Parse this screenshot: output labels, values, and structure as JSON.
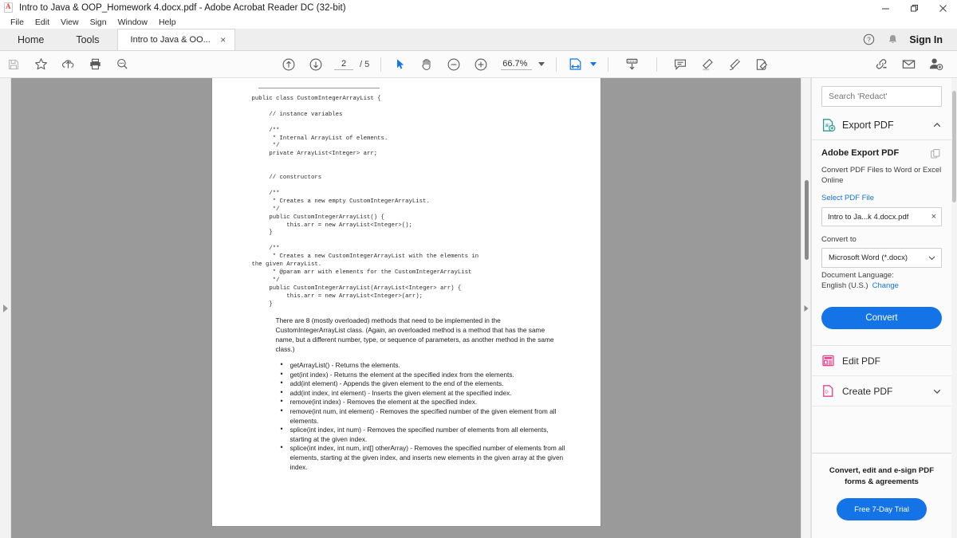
{
  "window": {
    "title": "Intro to Java & OOP_Homework 4.docx.pdf - Adobe Acrobat Reader DC (32-bit)",
    "minimize_label": "Minimize",
    "restore_label": "Restore",
    "close_label": "Close"
  },
  "menubar": {
    "items": [
      "File",
      "Edit",
      "View",
      "Sign",
      "Window",
      "Help"
    ]
  },
  "tabstrip": {
    "home": "Home",
    "tools": "Tools",
    "document_tab": "Intro to Java & OO...",
    "close_tab": "×",
    "help_icon": "help-circle-icon",
    "bell_icon": "notification-bell-icon",
    "sign_in": "Sign In"
  },
  "toolbar": {
    "save_icon": "save-icon",
    "star_icon": "add-to-favorites-star-icon",
    "upload_icon": "upload-to-cloud-icon",
    "print_icon": "print-icon",
    "search_icon": "search-magnifier-icon",
    "prev_page_icon": "previous-page-up-arrow-icon",
    "next_page_icon": "next-page-down-arrow-icon",
    "current_page": "2",
    "page_total": "/ 5",
    "select_tool_icon": "select-cursor-icon",
    "hand_tool_icon": "hand-pan-icon",
    "zoom_out_icon": "zoom-out-minus-icon",
    "zoom_in_icon": "zoom-in-plus-icon",
    "zoom_level": "66.7%",
    "zoom_dropdown_icon": "chevron-down-icon",
    "fit_page_icon": "fit-page-width-icon",
    "fit_page_dropdown_icon": "chevron-down-icon",
    "scroll_mode_icon": "page-scroll-down-icon",
    "comment_icon": "add-comment-icon",
    "highlight_icon": "highlight-text-icon",
    "draw_icon": "draw-freehand-icon",
    "fill_sign_icon": "fill-and-sign-icon",
    "share_link_icon": "share-link-icon",
    "email_icon": "send-email-icon",
    "add_person_icon": "add-person-icon"
  },
  "viewer": {
    "left_rail_expand_icon": "expand-left-panel-arrow-icon",
    "right_rail_expand_icon": "expand-right-panel-arrow-icon",
    "scrollbar_name": "document-vertical-scrollbar"
  },
  "document": {
    "code": "public class CustomIntegerArrayList {\n\n     // instance variables\n\n     /**\n      * Internal ArrayList of elements.\n      */\n     private ArrayList<Integer> arr;\n\n\n     // constructors\n\n     /**\n      * Creates a new empty CustomIntegerArrayList.\n      */\n     public CustomIntegerArrayList() {\n          this.arr = new ArrayList<Integer>();\n     }\n\n     /**\n      * Creates a new CustomIntegerArrayList with the elements in\nthe given ArrayList.\n      * @param arr with elements for the CustomIntegerArrayList\n      */\n     public CustomIntegerArrayList(ArrayList<Integer> arr) {\n          this.arr = new ArrayList<Integer>(arr);\n     }",
    "paragraph": "There are 8 (mostly overloaded) methods that need to be implemented in the CustomIntegerArrayList class.  (Again, an overloaded method is a method that has the same name, but a different number, type, or sequence of parameters, as another method in the same class.)",
    "bullets": [
      "getArrayList() - Returns the elements.",
      "get(int index) - Returns the element at the specified index from the elements.",
      "add(int element) - Appends the given element to the end of the elements.",
      "add(int index, int element) - Inserts the given element at the specified index.",
      "remove(int index) - Removes the element at the specified index.",
      "remove(int num, int element) - Removes the specified number of the given element from all elements.",
      "splice(int index, int num) - Removes the specified number of elements from all elements, starting at the given index.",
      "splice(int index, int num, int[] otherArray) - Removes the specified number of elements from all elements, starting at the given index, and inserts new elements in the given array at the given index."
    ]
  },
  "right_panel": {
    "search_placeholder": "Search 'Redact'",
    "export_pdf_header": "Export PDF",
    "export_pdf_icon": "export-pdf-icon",
    "collapse_icon": "chevron-up-icon",
    "card_title": "Adobe Export PDF",
    "copy_icon": "duplicate-pages-icon",
    "card_desc": "Convert PDF Files to Word or Excel Online",
    "select_file_link": "Select PDF File",
    "file_name": "Intro to Ja...k 4.docx.pdf",
    "file_remove_icon": "×",
    "convert_to_label": "Convert to",
    "convert_to_value": "Microsoft Word (*.docx)",
    "convert_to_dropdown_icon": "chevron-down-icon",
    "document_language_label": "Document Language:",
    "document_language_value": "English (U.S.)",
    "document_language_change": "Change",
    "convert_button": "Convert",
    "tools": [
      {
        "label": "Edit PDF",
        "icon": "edit-pdf-icon"
      },
      {
        "label": "Create PDF",
        "icon": "create-pdf-icon",
        "dropdown_icon": "chevron-down-icon"
      }
    ],
    "promo_text": "Convert, edit and e-sign PDF forms & agreements",
    "promo_button": "Free 7-Day Trial",
    "scrollbar_name": "right-panel-scrollbar"
  },
  "colors": {
    "accent_blue": "#1473e6",
    "link_blue": "#1473e6",
    "doc_bg_gray": "#9a9a9a",
    "panel_bg": "#fbfbfb",
    "edit_pdf_pink": "#e8408a",
    "export_teal": "#2c9a92"
  }
}
